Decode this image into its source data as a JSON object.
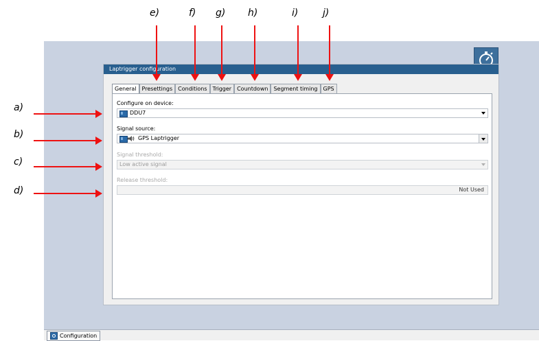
{
  "window": {
    "title": "Laptrigger configuration"
  },
  "tabs": [
    {
      "label": "General",
      "active": true
    },
    {
      "label": "Presettings"
    },
    {
      "label": "Conditions"
    },
    {
      "label": "Trigger"
    },
    {
      "label": "Countdown"
    },
    {
      "label": "Segment timing"
    },
    {
      "label": "GPS"
    }
  ],
  "form": {
    "configure_label": "Configure on device:",
    "configure_value": "DDU7",
    "signal_source_label": "Signal source:",
    "signal_source_value": "GPS Laptrigger",
    "signal_threshold_label": "Signal threshold:",
    "signal_threshold_value": "Low active signal",
    "release_threshold_label": "Release threshold:",
    "release_threshold_value": "Not Used"
  },
  "taskbar": {
    "configuration_label": "Configuration"
  },
  "annotations": {
    "left": [
      "a)",
      "b)",
      "c)",
      "d)"
    ],
    "top": [
      "e)",
      "f)",
      "g)",
      "h)",
      "i)",
      "j)"
    ]
  },
  "colors": {
    "titlebar": "#285f8f",
    "arrow": "#ee1111",
    "background": "#c9d2e1"
  },
  "icons": [
    "stopwatch-icon",
    "device-icon",
    "speaker-icon",
    "dropdown-caret-icon"
  ]
}
